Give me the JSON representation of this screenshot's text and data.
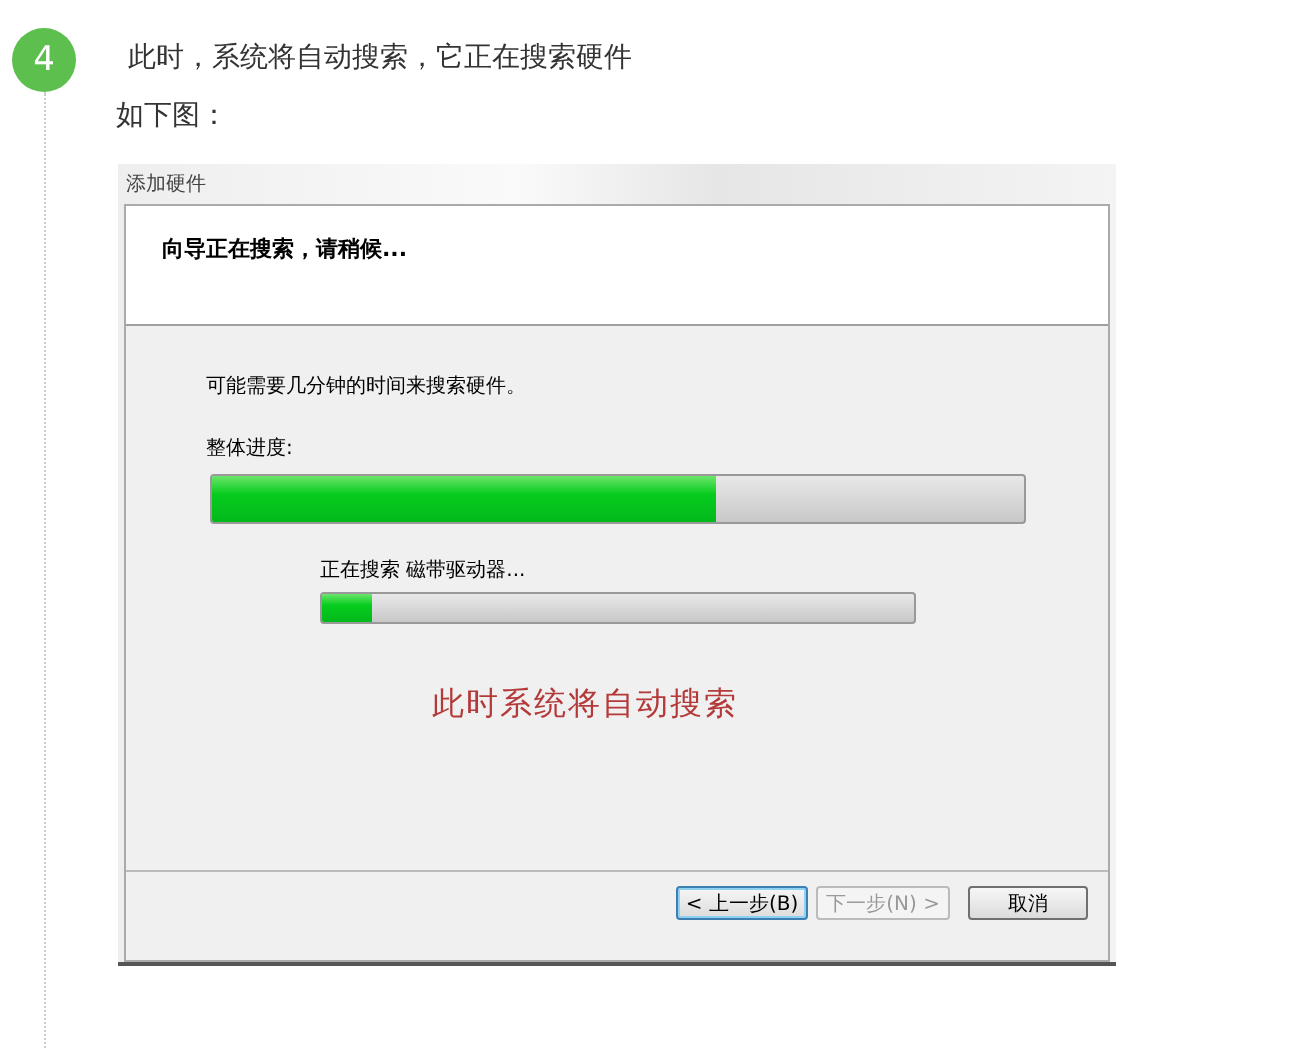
{
  "step": {
    "number": "4",
    "text": "此时，系统将自动搜索，它正在搜索硬件",
    "subtext": "如下图："
  },
  "dialog": {
    "title": "添加硬件",
    "heading": "向导正在搜索，请稍候...",
    "note": "可能需要几分钟的时间来搜索硬件。",
    "progress": [
      {
        "label": "整体进度:",
        "level": 0.62
      },
      {
        "label": "正在搜索 磁带驱动器...",
        "level": 0.085
      }
    ],
    "annotation": "此时系统将自动搜索",
    "buttons": [
      {
        "label": "< 上一步(B)",
        "focused": true,
        "disabled": false
      },
      {
        "label": "下一步(N) >",
        "focused": false,
        "disabled": true
      },
      {
        "label": "取消",
        "focused": false,
        "disabled": false
      }
    ]
  }
}
